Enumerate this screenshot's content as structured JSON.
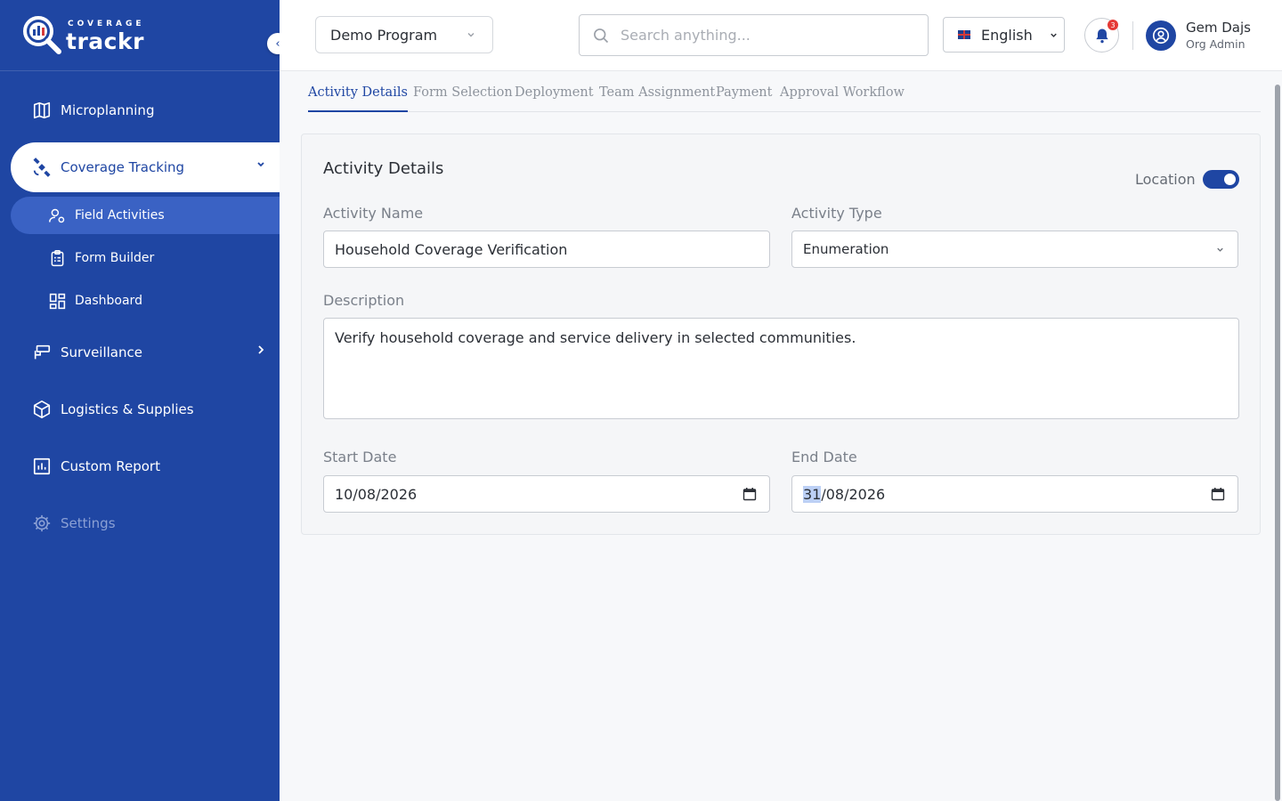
{
  "brand": {
    "top": "COVERAGE",
    "main": "trackr"
  },
  "sidebar": {
    "items": [
      {
        "label": "Microplanning"
      },
      {
        "label": "Coverage Tracking"
      },
      {
        "label": "Surveillance"
      },
      {
        "label": "Logistics & Supplies"
      },
      {
        "label": "Custom Report"
      },
      {
        "label": "Settings"
      }
    ],
    "sub_items": [
      {
        "label": "Field Activities"
      },
      {
        "label": "Form Builder"
      },
      {
        "label": "Dashboard"
      }
    ]
  },
  "header": {
    "program": "Demo Program",
    "search_placeholder": "Search anything...",
    "language": "English",
    "notification_count": "3",
    "user_name": "Gem Dajs",
    "user_role": "Org Admin"
  },
  "tabs": [
    {
      "label": "Activity Details"
    },
    {
      "label": "Form Selection"
    },
    {
      "label": "Deployment"
    },
    {
      "label": "Team Assignment"
    },
    {
      "label": "Payment"
    },
    {
      "label": "Approval Workflow"
    }
  ],
  "form": {
    "title": "Activity Details",
    "location_label": "Location",
    "location_enabled": true,
    "activity_name_label": "Activity Name",
    "activity_name": "Household Coverage Verification",
    "activity_type_label": "Activity Type",
    "activity_type": "Enumeration",
    "description_label": "Description",
    "description": "Verify household coverage and service delivery in selected communities.",
    "start_date_label": "Start Date",
    "start_date": "10/08/2026",
    "end_date_label": "End Date",
    "end_date_day": "31",
    "end_date_rest": "/08/2026"
  },
  "colors": {
    "primary": "#1f46a3",
    "sidebar_sub_active": "#3a62c4",
    "badge": "#e53935"
  }
}
